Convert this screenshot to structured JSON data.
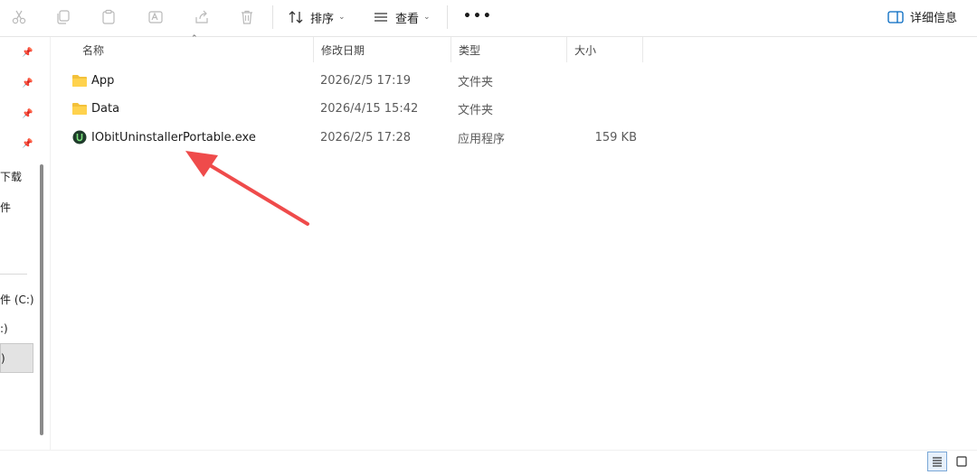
{
  "toolbar": {
    "icons": [
      "cut-icon",
      "copy-icon",
      "paste-icon",
      "rename-icon",
      "share-icon",
      "delete-icon"
    ],
    "sort_label": "排序",
    "view_label": "查看",
    "more_label": "•••",
    "details_label": "详细信息"
  },
  "nav": {
    "items": [
      {
        "label": "下载"
      },
      {
        "label": "件"
      },
      {
        "label": "件 (C:)"
      },
      {
        "label": ":)"
      },
      {
        "label": ")"
      }
    ]
  },
  "columns": {
    "name": "名称",
    "date": "修改日期",
    "type": "类型",
    "size": "大小"
  },
  "files": [
    {
      "name": "App",
      "date": "2026/2/5 17:19",
      "type": "文件夹",
      "size": "",
      "icon": "folder-icon"
    },
    {
      "name": "Data",
      "date": "2026/4/15 15:42",
      "type": "文件夹",
      "size": "",
      "icon": "folder-icon"
    },
    {
      "name": "IObitUninstallerPortable.exe",
      "date": "2026/2/5 17:28",
      "type": "应用程序",
      "size": "159 KB",
      "icon": "iobit-app-icon"
    }
  ],
  "annotation": {
    "icon": "red-arrow-annotation",
    "color": "#ef4b4b"
  },
  "colors": {
    "accent": "#0067c0",
    "folder": "#f3c13a",
    "arrow": "#ef4b4b"
  }
}
